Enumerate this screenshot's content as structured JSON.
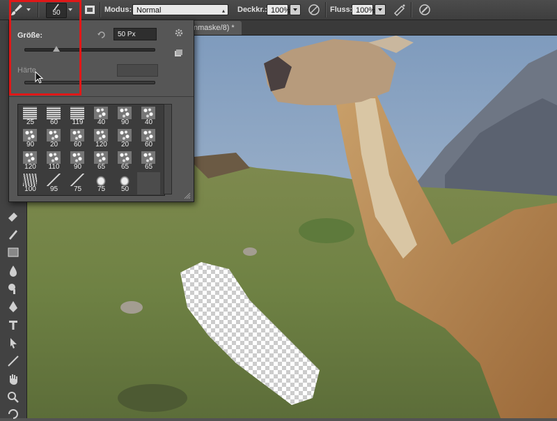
{
  "options_bar": {
    "brush_size": "50",
    "mode_label": "Modus:",
    "mode_value": "Normal",
    "opacity_label": "Deckkr.:",
    "opacity_value": "100%",
    "flow_label": "Fluss:",
    "flow_value": "100%"
  },
  "document": {
    "tab_title": "nmaske/8) *"
  },
  "brush_panel": {
    "size_label": "Größe:",
    "size_value": "50 Px",
    "size_fraction": 0.24,
    "hardness_label": "Härte",
    "hardness_fraction": 0.0,
    "presets": [
      {
        "size": "25",
        "texture": "dots"
      },
      {
        "size": "60",
        "texture": "dots"
      },
      {
        "size": "119",
        "texture": "dots"
      },
      {
        "size": "40",
        "texture": "spray"
      },
      {
        "size": "90",
        "texture": "spray"
      },
      {
        "size": "40",
        "texture": "spray"
      },
      {
        "size": "90",
        "texture": "spray"
      },
      {
        "size": "20",
        "texture": "spray"
      },
      {
        "size": "60",
        "texture": "spray"
      },
      {
        "size": "120",
        "texture": "spray"
      },
      {
        "size": "20",
        "texture": "spray"
      },
      {
        "size": "60",
        "texture": "spray"
      },
      {
        "size": "120",
        "texture": "spray"
      },
      {
        "size": "110",
        "texture": "spray"
      },
      {
        "size": "90",
        "texture": "spray"
      },
      {
        "size": "65",
        "texture": "spray"
      },
      {
        "size": "65",
        "texture": "spray"
      },
      {
        "size": "65",
        "texture": "spray"
      },
      {
        "size": "100",
        "texture": "grass"
      },
      {
        "size": "95",
        "texture": "line"
      },
      {
        "size": "75",
        "texture": "line"
      },
      {
        "size": "75",
        "texture": "leaf"
      },
      {
        "size": "50",
        "texture": "leaf"
      }
    ]
  },
  "colors": {
    "highlight": "#e01818",
    "panel_bg": "#565656",
    "toolbar_bg": "#424242"
  },
  "icons": [
    "brush-icon",
    "brush-settings-icon",
    "airbrush-icon",
    "pressure-opacity-icon",
    "pressure-size-icon",
    "gear-icon",
    "reset-icon",
    "new-preset-icon"
  ]
}
